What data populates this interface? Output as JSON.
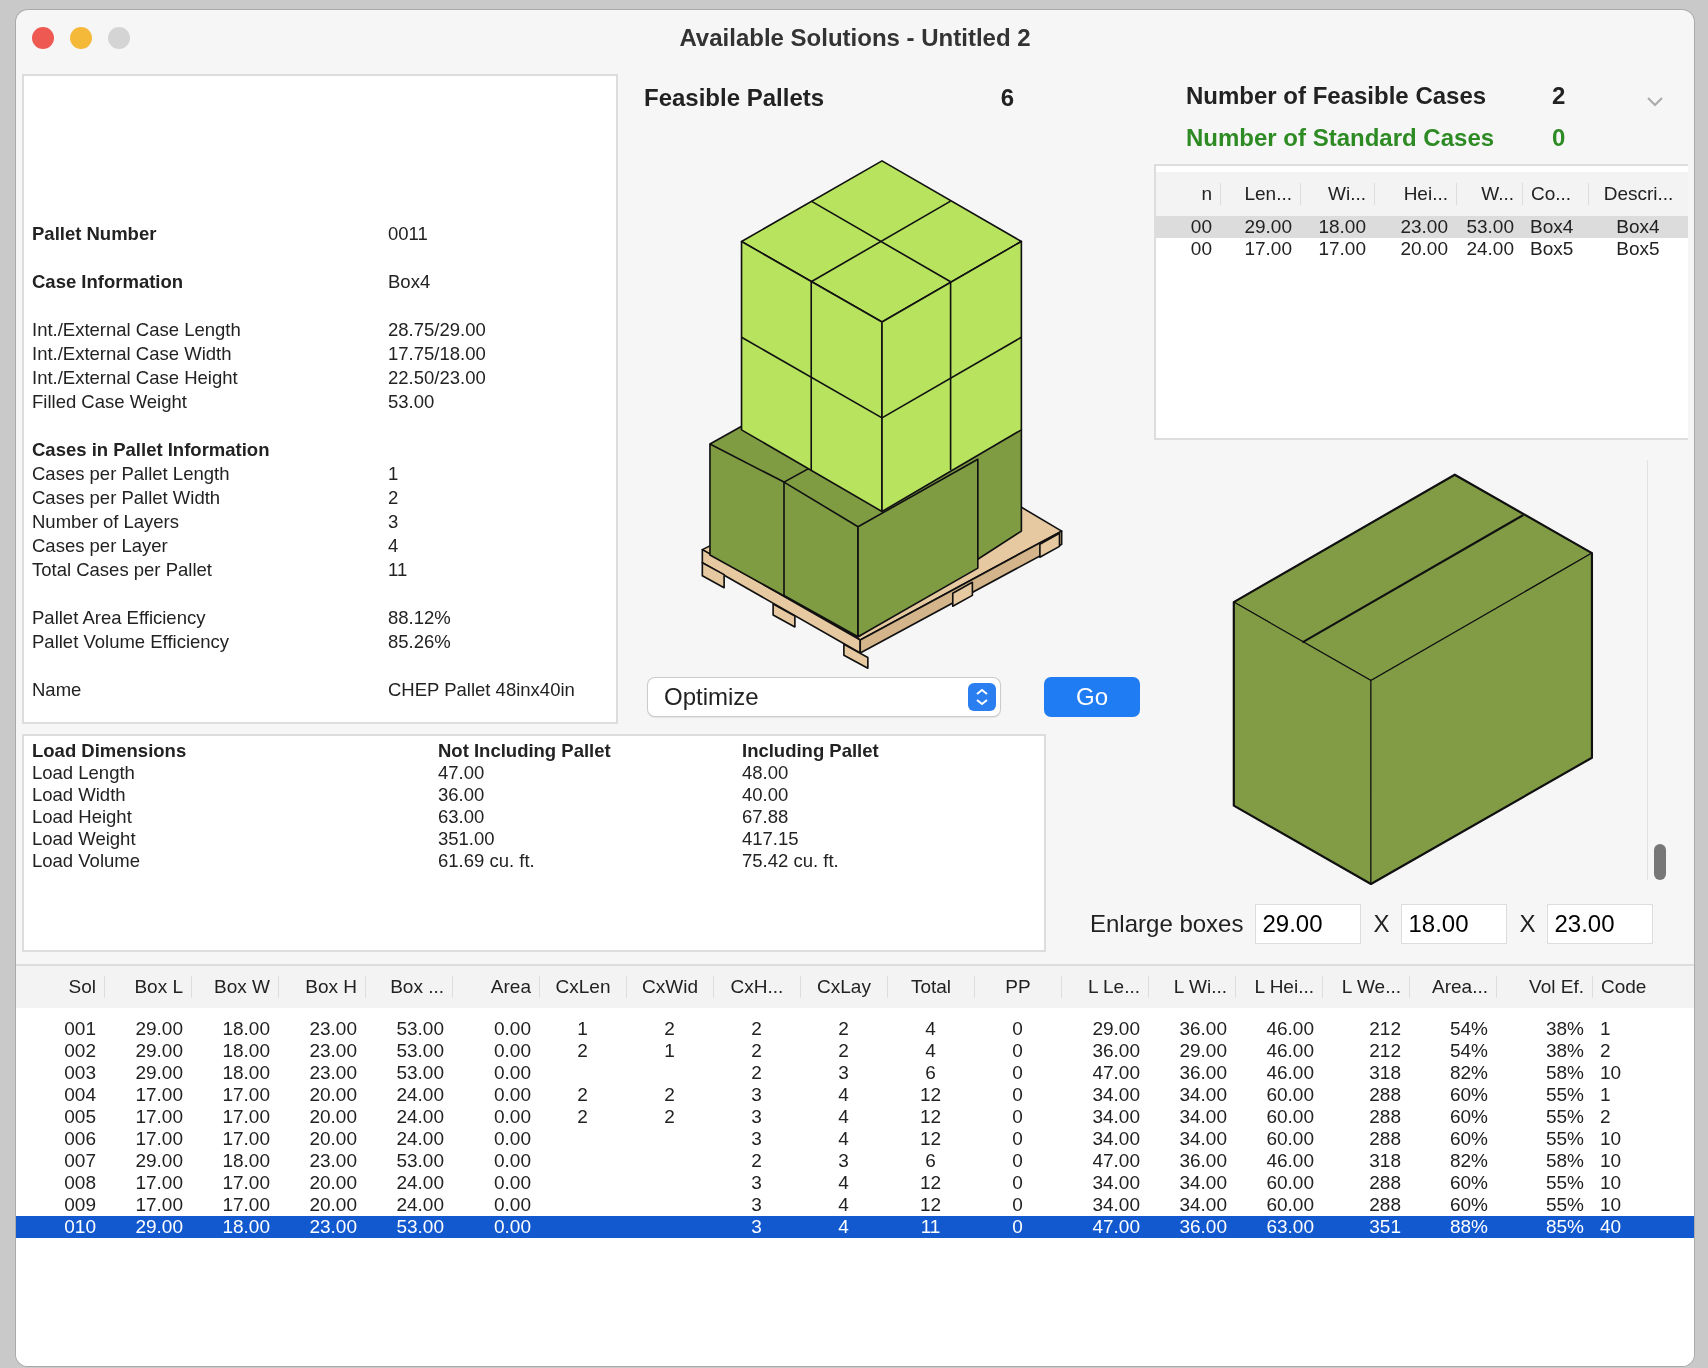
{
  "window": {
    "title": "Available Solutions - Untitled 2"
  },
  "pallet_info": [
    {
      "kind": "heading",
      "label": "Pallet Number",
      "value": "0011"
    },
    {
      "kind": "gap"
    },
    {
      "kind": "heading",
      "label": "Case Information",
      "value": "Box4"
    },
    {
      "kind": "gap"
    },
    {
      "kind": "row",
      "label": "Int./External Case Length",
      "value": "28.75/29.00"
    },
    {
      "kind": "row",
      "label": "Int./External Case Width",
      "value": "17.75/18.00"
    },
    {
      "kind": "row",
      "label": "Int./External Case Height",
      "value": "22.50/23.00"
    },
    {
      "kind": "row",
      "label": "Filled Case Weight",
      "value": "53.00"
    },
    {
      "kind": "gap"
    },
    {
      "kind": "heading",
      "label": "Cases in Pallet Information"
    },
    {
      "kind": "row",
      "label": "Cases per Pallet Length",
      "value": "1"
    },
    {
      "kind": "row",
      "label": "Cases per Pallet Width",
      "value": "2"
    },
    {
      "kind": "row",
      "label": "Number of Layers",
      "value": "3"
    },
    {
      "kind": "row",
      "label": "Cases per Layer",
      "value": "4"
    },
    {
      "kind": "row",
      "label": "Total Cases per Pallet",
      "value": "11"
    },
    {
      "kind": "gap"
    },
    {
      "kind": "row",
      "label": "Pallet Area Efficiency",
      "value": "88.12%"
    },
    {
      "kind": "row",
      "label": "Pallet Volume Efficiency",
      "value": "85.26%"
    },
    {
      "kind": "gap"
    },
    {
      "kind": "row",
      "label": "Name",
      "value": "CHEP Pallet 48inx40in"
    }
  ],
  "feasible_pallets": {
    "label": "Feasible Pallets",
    "count": "6"
  },
  "optimize_select": {
    "value": "Optimize"
  },
  "go_button": "Go",
  "load_dimensions": {
    "columns": [
      "Load Dimensions",
      "Not Including Pallet",
      "Including Pallet"
    ],
    "rows": [
      [
        "Load Length",
        "47.00",
        "48.00"
      ],
      [
        "Load Width",
        "36.00",
        "40.00"
      ],
      [
        "Load Height",
        "63.00",
        "67.88"
      ],
      [
        "Load Weight",
        "351.00",
        "417.15"
      ],
      [
        "Load Volume",
        "61.69 cu. ft.",
        "75.42 cu. ft."
      ]
    ]
  },
  "feasible_cases": {
    "label": "Number of Feasible Cases",
    "count": "2"
  },
  "standard_cases": {
    "label": "Number of Standard Cases",
    "count": "0"
  },
  "cases_table": {
    "columns": [
      "n",
      "Len...",
      "Wi...",
      "Hei...",
      "W...",
      "Co...",
      "Descri..."
    ],
    "rows": [
      {
        "selected": true,
        "cells": [
          "00",
          "29.00",
          "18.00",
          "23.00",
          "53.00",
          "Box4",
          "Box4"
        ]
      },
      {
        "selected": false,
        "cells": [
          "00",
          "17.00",
          "17.00",
          "20.00",
          "24.00",
          "Box5",
          "Box5"
        ]
      }
    ]
  },
  "enlarge": {
    "label": "Enlarge boxes",
    "values": [
      "29.00",
      "18.00",
      "23.00"
    ],
    "separators": [
      "X",
      "X"
    ]
  },
  "solutions_table": {
    "columns": [
      "Sol",
      "Box L",
      "Box W",
      "Box H",
      "Box ...",
      "Area",
      "CxLen",
      "CxWid",
      "CxH...",
      "CxLay",
      "Total",
      "PP",
      "L Le...",
      "L Wi...",
      "L Hei...",
      "L We...",
      "Area...",
      "Vol Ef.",
      "Code"
    ],
    "rows": [
      {
        "selected": false,
        "cells": [
          "001",
          "29.00",
          "18.00",
          "23.00",
          "53.00",
          "0.00",
          "1",
          "2",
          "2",
          "2",
          "4",
          "0",
          "29.00",
          "36.00",
          "46.00",
          "212",
          "54%",
          "38%",
          "1"
        ]
      },
      {
        "selected": false,
        "cells": [
          "002",
          "29.00",
          "18.00",
          "23.00",
          "53.00",
          "0.00",
          "2",
          "1",
          "2",
          "2",
          "4",
          "0",
          "36.00",
          "29.00",
          "46.00",
          "212",
          "54%",
          "38%",
          "2"
        ]
      },
      {
        "selected": false,
        "cells": [
          "003",
          "29.00",
          "18.00",
          "23.00",
          "53.00",
          "0.00",
          null,
          null,
          "2",
          "3",
          "6",
          "0",
          "47.00",
          "36.00",
          "46.00",
          "318",
          "82%",
          "58%",
          "10"
        ]
      },
      {
        "selected": false,
        "cells": [
          "004",
          "17.00",
          "17.00",
          "20.00",
          "24.00",
          "0.00",
          "2",
          "2",
          "3",
          "4",
          "12",
          "0",
          "34.00",
          "34.00",
          "60.00",
          "288",
          "60%",
          "55%",
          "1"
        ]
      },
      {
        "selected": false,
        "cells": [
          "005",
          "17.00",
          "17.00",
          "20.00",
          "24.00",
          "0.00",
          "2",
          "2",
          "3",
          "4",
          "12",
          "0",
          "34.00",
          "34.00",
          "60.00",
          "288",
          "60%",
          "55%",
          "2"
        ]
      },
      {
        "selected": false,
        "cells": [
          "006",
          "17.00",
          "17.00",
          "20.00",
          "24.00",
          "0.00",
          null,
          null,
          "3",
          "4",
          "12",
          "0",
          "34.00",
          "34.00",
          "60.00",
          "288",
          "60%",
          "55%",
          "10"
        ]
      },
      {
        "selected": false,
        "cells": [
          "007",
          "29.00",
          "18.00",
          "23.00",
          "53.00",
          "0.00",
          null,
          null,
          "2",
          "3",
          "6",
          "0",
          "47.00",
          "36.00",
          "46.00",
          "318",
          "82%",
          "58%",
          "10"
        ]
      },
      {
        "selected": false,
        "cells": [
          "008",
          "17.00",
          "17.00",
          "20.00",
          "24.00",
          "0.00",
          null,
          null,
          "3",
          "4",
          "12",
          "0",
          "34.00",
          "34.00",
          "60.00",
          "288",
          "60%",
          "55%",
          "10"
        ]
      },
      {
        "selected": false,
        "cells": [
          "009",
          "17.00",
          "17.00",
          "20.00",
          "24.00",
          "0.00",
          null,
          null,
          "3",
          "4",
          "12",
          "0",
          "34.00",
          "34.00",
          "60.00",
          "288",
          "60%",
          "55%",
          "10"
        ]
      },
      {
        "selected": true,
        "cells": [
          "010",
          "29.00",
          "18.00",
          "23.00",
          "53.00",
          "0.00",
          null,
          null,
          "3",
          "4",
          "11",
          "0",
          "47.00",
          "36.00",
          "63.00",
          "351",
          "88%",
          "85%",
          "40"
        ]
      }
    ]
  }
}
